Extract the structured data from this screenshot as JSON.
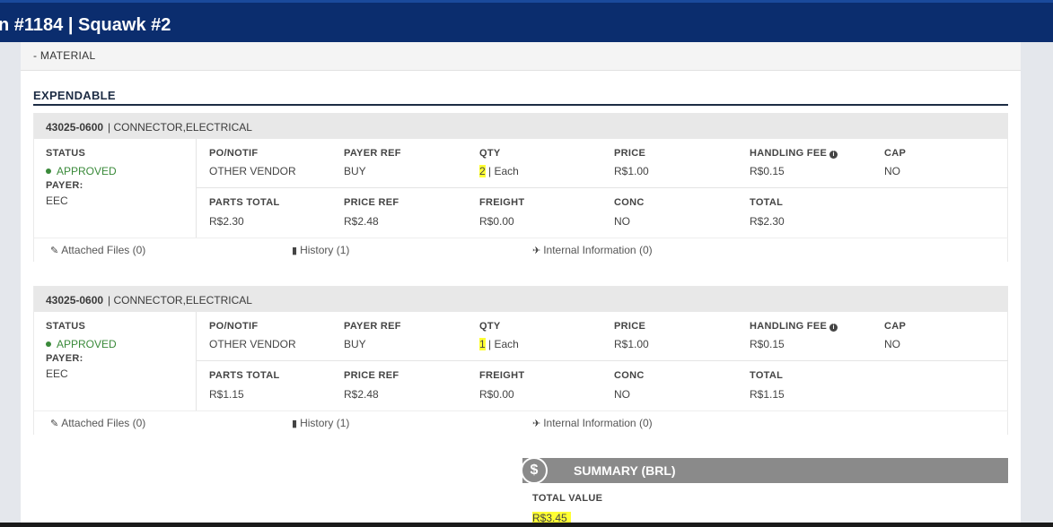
{
  "header": {
    "title": "n #1184 | Squawk #2"
  },
  "section": {
    "label": "- MATERIAL"
  },
  "group": {
    "title": "EXPENDABLE"
  },
  "labels": {
    "status": "STATUS",
    "payer": "PAYER:",
    "po_notif": "PO/NOTIF",
    "payer_ref": "PAYER REF",
    "qty": "QTY",
    "price": "PRICE",
    "handling_fee": "HANDLING FEE",
    "cap": "CAP",
    "parts_total": "PARTS TOTAL",
    "price_ref": "PRICE REF",
    "freight": "FREIGHT",
    "conc": "CONC",
    "total": "TOTAL"
  },
  "items": [
    {
      "part_number": "43025-0600",
      "description": "| CONNECTOR,ELECTRICAL",
      "status": "APPROVED",
      "payer": "EEC",
      "po_notif": "OTHER VENDOR",
      "payer_ref": "BUY",
      "qty": "2",
      "unit": "| Each",
      "price": "R$1.00",
      "handling_fee": "R$0.15",
      "cap": "NO",
      "parts_total": "R$2.30",
      "price_ref": "R$2.48",
      "freight": "R$0.00",
      "conc": "NO",
      "total": "R$2.30",
      "attached_files": "Attached Files (0)",
      "history": "History (1)",
      "internal_info": "Internal Information (0)"
    },
    {
      "part_number": "43025-0600",
      "description": "| CONNECTOR,ELECTRICAL",
      "status": "APPROVED",
      "payer": "EEC",
      "po_notif": "OTHER VENDOR",
      "payer_ref": "BUY",
      "qty": "1",
      "unit": "| Each",
      "price": "R$1.00",
      "handling_fee": "R$0.15",
      "cap": "NO",
      "parts_total": "R$1.15",
      "price_ref": "R$2.48",
      "freight": "R$0.00",
      "conc": "NO",
      "total": "R$1.15",
      "attached_files": "Attached Files (0)",
      "history": "History (1)",
      "internal_info": "Internal Information (0)"
    }
  ],
  "summary": {
    "icon_glyph": "$",
    "title": "SUMMARY (BRL)",
    "total_label": "TOTAL VALUE",
    "total_value": "R$3.45"
  },
  "colors": {
    "header_bg": "#0b2d6e",
    "approved": "#3a8a3a",
    "highlight": "#ffff33",
    "summary_bg": "#8a8a8a"
  },
  "icons": {
    "attach": "paperclip-icon",
    "history": "book-icon",
    "internal": "plane-icon",
    "info": "info-icon",
    "summary": "dollar-coin-icon"
  }
}
